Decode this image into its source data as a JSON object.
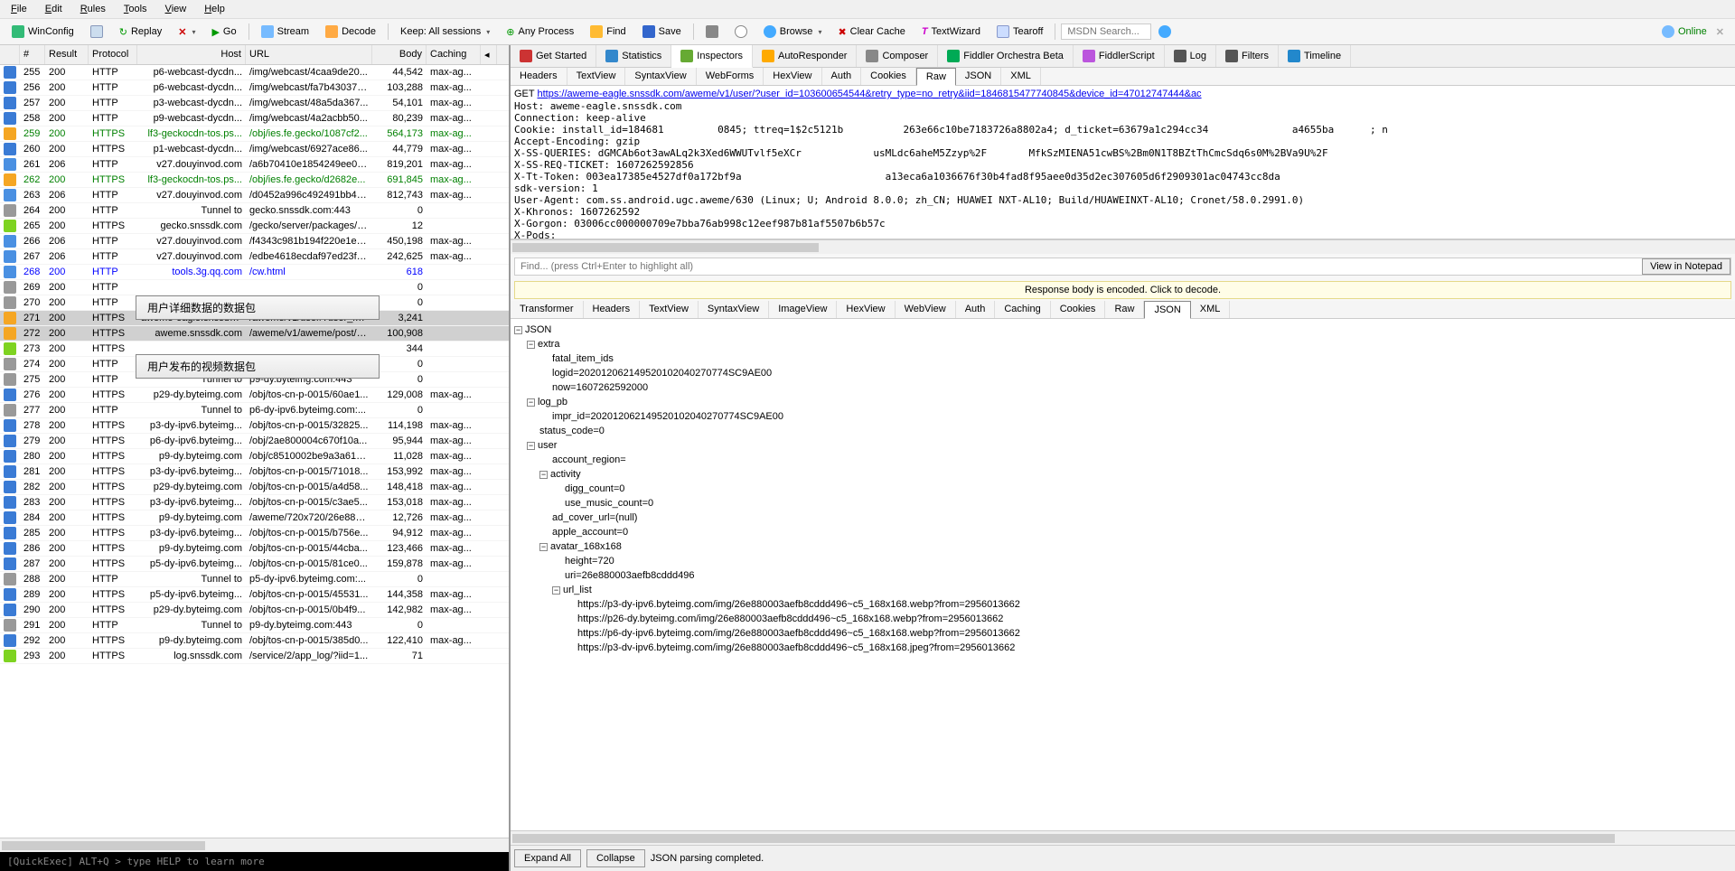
{
  "menu": [
    "File",
    "Edit",
    "Rules",
    "Tools",
    "View",
    "Help"
  ],
  "toolbar": {
    "winconfig": "WinConfig",
    "replay": "Replay",
    "go": "Go",
    "stream": "Stream",
    "decode": "Decode",
    "keep": "Keep: All sessions",
    "any_process": "Any Process",
    "find": "Find",
    "save": "Save",
    "browse": "Browse",
    "clear_cache": "Clear Cache",
    "textwizard": "TextWizard",
    "tearoff": "Tearoff",
    "search_placeholder": "MSDN Search...",
    "online": "Online"
  },
  "session_cols": {
    "id": "#",
    "result": "Result",
    "protocol": "Protocol",
    "host": "Host",
    "url": "URL",
    "body": "Body",
    "caching": "Caching"
  },
  "sessions": [
    {
      "id": "255",
      "result": "200",
      "proto": "HTTP",
      "host": "p6-webcast-dycdn...",
      "url": "/img/webcast/4caa9de20...",
      "body": "44,542",
      "cache": "max-ag...",
      "ico": "img"
    },
    {
      "id": "256",
      "result": "200",
      "proto": "HTTP",
      "host": "p6-webcast-dycdn...",
      "url": "/img/webcast/fa7b43037e...",
      "body": "103,288",
      "cache": "max-ag...",
      "ico": "img"
    },
    {
      "id": "257",
      "result": "200",
      "proto": "HTTP",
      "host": "p3-webcast-dycdn...",
      "url": "/img/webcast/48a5da367...",
      "body": "54,101",
      "cache": "max-ag...",
      "ico": "img"
    },
    {
      "id": "258",
      "result": "200",
      "proto": "HTTP",
      "host": "p9-webcast-dycdn...",
      "url": "/img/webcast/4a2acbb50...",
      "body": "80,239",
      "cache": "max-ag...",
      "ico": "img"
    },
    {
      "id": "259",
      "result": "200",
      "proto": "HTTPS",
      "host": "lf3-geckocdn-tos.ps...",
      "url": "/obj/ies.fe.gecko/1087cf2...",
      "body": "564,173",
      "cache": "max-ag...",
      "ico": "js",
      "green": true
    },
    {
      "id": "260",
      "result": "200",
      "proto": "HTTPS",
      "host": "p1-webcast-dycdn...",
      "url": "/img/webcast/6927ace86...",
      "body": "44,779",
      "cache": "max-ag...",
      "ico": "img"
    },
    {
      "id": "261",
      "result": "206",
      "proto": "HTTP",
      "host": "v27.douyinvod.com",
      "url": "/a6b70410e1854249ee03...",
      "body": "819,201",
      "cache": "max-ag...",
      "ico": "doc"
    },
    {
      "id": "262",
      "result": "200",
      "proto": "HTTPS",
      "host": "lf3-geckocdn-tos.ps...",
      "url": "/obj/ies.fe.gecko/d2682e...",
      "body": "691,845",
      "cache": "max-ag...",
      "ico": "js",
      "green": true
    },
    {
      "id": "263",
      "result": "206",
      "proto": "HTTP",
      "host": "v27.douyinvod.com",
      "url": "/d0452a996c492491bb47...",
      "body": "812,743",
      "cache": "max-ag...",
      "ico": "doc"
    },
    {
      "id": "264",
      "result": "200",
      "proto": "HTTP",
      "host": "Tunnel to",
      "url": "gecko.snssdk.com:443",
      "body": "0",
      "cache": "",
      "ico": "lock"
    },
    {
      "id": "265",
      "result": "200",
      "proto": "HTTPS",
      "host": "gecko.snssdk.com",
      "url": "/gecko/server/packages/s...",
      "body": "12",
      "cache": "",
      "ico": "json"
    },
    {
      "id": "266",
      "result": "206",
      "proto": "HTTP",
      "host": "v27.douyinvod.com",
      "url": "/f4343c981b194f220e1eb...",
      "body": "450,198",
      "cache": "max-ag...",
      "ico": "doc"
    },
    {
      "id": "267",
      "result": "206",
      "proto": "HTTP",
      "host": "v27.douyinvod.com",
      "url": "/edbe4618ecdaf97ed23f9...",
      "body": "242,625",
      "cache": "max-ag...",
      "ico": "doc"
    },
    {
      "id": "268",
      "result": "200",
      "proto": "HTTP",
      "host": "tools.3g.qq.com",
      "url": "/cw.html",
      "body": "618",
      "cache": "",
      "ico": "html",
      "blue": true
    },
    {
      "id": "269",
      "result": "200",
      "proto": "HTTP",
      "host": "",
      "url": "",
      "body": "0",
      "cache": "",
      "ico": "lock"
    },
    {
      "id": "270",
      "result": "200",
      "proto": "HTTP",
      "host": "",
      "url": "",
      "body": "0",
      "cache": "",
      "ico": "lock"
    },
    {
      "id": "271",
      "result": "200",
      "proto": "HTTPS",
      "host": "aweme-eagle.snssdk...",
      "url": "/aweme/v1/user/?user_id...",
      "body": "3,241",
      "cache": "",
      "ico": "js",
      "sel": true
    },
    {
      "id": "272",
      "result": "200",
      "proto": "HTTPS",
      "host": "aweme.snssdk.com",
      "url": "/aweme/v1/aweme/post/?...",
      "body": "100,908",
      "cache": "",
      "ico": "js",
      "sel": true
    },
    {
      "id": "273",
      "result": "200",
      "proto": "HTTPS",
      "host": "",
      "url": "",
      "body": "344",
      "cache": "",
      "ico": "json"
    },
    {
      "id": "274",
      "result": "200",
      "proto": "HTTP",
      "host": "",
      "url": "",
      "body": "0",
      "cache": "",
      "ico": "lock"
    },
    {
      "id": "275",
      "result": "200",
      "proto": "HTTP",
      "host": "Tunnel to",
      "url": "p9-dy.byteimg.com:443",
      "body": "0",
      "cache": "",
      "ico": "lock"
    },
    {
      "id": "276",
      "result": "200",
      "proto": "HTTPS",
      "host": "p29-dy.byteimg.com",
      "url": "/obj/tos-cn-p-0015/60ae1...",
      "body": "129,008",
      "cache": "max-ag...",
      "ico": "img"
    },
    {
      "id": "277",
      "result": "200",
      "proto": "HTTP",
      "host": "Tunnel to",
      "url": "p6-dy-ipv6.byteimg.com:...",
      "body": "0",
      "cache": "",
      "ico": "lock"
    },
    {
      "id": "278",
      "result": "200",
      "proto": "HTTPS",
      "host": "p3-dy-ipv6.byteimg...",
      "url": "/obj/tos-cn-p-0015/32825...",
      "body": "114,198",
      "cache": "max-ag...",
      "ico": "img"
    },
    {
      "id": "279",
      "result": "200",
      "proto": "HTTPS",
      "host": "p6-dy-ipv6.byteimg...",
      "url": "/obj/2ae800004c670f10a...",
      "body": "95,944",
      "cache": "max-ag...",
      "ico": "img"
    },
    {
      "id": "280",
      "result": "200",
      "proto": "HTTPS",
      "host": "p9-dy.byteimg.com",
      "url": "/obj/c8510002be9a3a61a...",
      "body": "11,028",
      "cache": "max-ag...",
      "ico": "img"
    },
    {
      "id": "281",
      "result": "200",
      "proto": "HTTPS",
      "host": "p3-dy-ipv6.byteimg...",
      "url": "/obj/tos-cn-p-0015/71018...",
      "body": "153,992",
      "cache": "max-ag...",
      "ico": "img"
    },
    {
      "id": "282",
      "result": "200",
      "proto": "HTTPS",
      "host": "p29-dy.byteimg.com",
      "url": "/obj/tos-cn-p-0015/a4d58...",
      "body": "148,418",
      "cache": "max-ag...",
      "ico": "img"
    },
    {
      "id": "283",
      "result": "200",
      "proto": "HTTPS",
      "host": "p3-dy-ipv6.byteimg...",
      "url": "/obj/tos-cn-p-0015/c3ae5...",
      "body": "153,018",
      "cache": "max-ag...",
      "ico": "img"
    },
    {
      "id": "284",
      "result": "200",
      "proto": "HTTPS",
      "host": "p9-dy.byteimg.com",
      "url": "/aweme/720x720/26e880...",
      "body": "12,726",
      "cache": "max-ag...",
      "ico": "img"
    },
    {
      "id": "285",
      "result": "200",
      "proto": "HTTPS",
      "host": "p3-dy-ipv6.byteimg...",
      "url": "/obj/tos-cn-p-0015/b756e...",
      "body": "94,912",
      "cache": "max-ag...",
      "ico": "img"
    },
    {
      "id": "286",
      "result": "200",
      "proto": "HTTPS",
      "host": "p9-dy.byteimg.com",
      "url": "/obj/tos-cn-p-0015/44cba...",
      "body": "123,466",
      "cache": "max-ag...",
      "ico": "img"
    },
    {
      "id": "287",
      "result": "200",
      "proto": "HTTPS",
      "host": "p5-dy-ipv6.byteimg...",
      "url": "/obj/tos-cn-p-0015/81ce0...",
      "body": "159,878",
      "cache": "max-ag...",
      "ico": "img"
    },
    {
      "id": "288",
      "result": "200",
      "proto": "HTTP",
      "host": "Tunnel to",
      "url": "p5-dy-ipv6.byteimg.com:...",
      "body": "0",
      "cache": "",
      "ico": "lock"
    },
    {
      "id": "289",
      "result": "200",
      "proto": "HTTPS",
      "host": "p5-dy-ipv6.byteimg...",
      "url": "/obj/tos-cn-p-0015/45531...",
      "body": "144,358",
      "cache": "max-ag...",
      "ico": "img"
    },
    {
      "id": "290",
      "result": "200",
      "proto": "HTTPS",
      "host": "p29-dy.byteimg.com",
      "url": "/obj/tos-cn-p-0015/0b4f9...",
      "body": "142,982",
      "cache": "max-ag...",
      "ico": "img"
    },
    {
      "id": "291",
      "result": "200",
      "proto": "HTTP",
      "host": "Tunnel to",
      "url": "p9-dy.byteimg.com:443",
      "body": "0",
      "cache": "",
      "ico": "lock"
    },
    {
      "id": "292",
      "result": "200",
      "proto": "HTTPS",
      "host": "p9-dy.byteimg.com",
      "url": "/obj/tos-cn-p-0015/385d0...",
      "body": "122,410",
      "cache": "max-ag...",
      "ico": "img"
    },
    {
      "id": "293",
      "result": "200",
      "proto": "HTTPS",
      "host": "log.snssdk.com",
      "url": "/service/2/app_log/?iid=1...",
      "body": "71",
      "cache": "",
      "ico": "json"
    }
  ],
  "annotations": {
    "a1": "用户详细数据的数据包",
    "a2": "用户发布的视频数据包"
  },
  "top_tabs": [
    "Get Started",
    "Statistics",
    "Inspectors",
    "AutoResponder",
    "Composer",
    "Fiddler Orchestra Beta",
    "FiddlerScript",
    "Log",
    "Filters",
    "Timeline"
  ],
  "req_tabs": [
    "Headers",
    "TextView",
    "SyntaxView",
    "WebForms",
    "HexView",
    "Auth",
    "Cookies",
    "Raw",
    "JSON",
    "XML"
  ],
  "resp_tabs": [
    "Transformer",
    "Headers",
    "TextView",
    "SyntaxView",
    "ImageView",
    "HexView",
    "WebView",
    "Auth",
    "Caching",
    "Cookies",
    "Raw",
    "JSON",
    "XML"
  ],
  "req_raw": {
    "method": "GET ",
    "url": "https://aweme-eagle.snssdk.com/aweme/v1/user/?user_id=103600654544&retry_type=no_retry&iid=1846815477740845&device_id=47012747444&ac",
    "lines": [
      "Host: aweme-eagle.snssdk.com",
      "Connection: keep-alive",
      "Cookie: install_id=184681         0845; ttreq=1$2c5121b          263e66c10be7183726a8802a4; d_ticket=63679a1c294cc34              a4655ba      ; n",
      "Accept-Encoding: gzip",
      "X-SS-QUERIES: dGMCAb6ot3awALq2k3Xed6WWUTvlf5eXCr            usMLdc6aheM5Zzyp%2F       MfkSzMIENA51cwBS%2Bm0N1T8BZtThCmcSdq6s0M%2BVa9U%2F",
      "X-SS-REQ-TICKET: 1607262592856",
      "X-Tt-Token: 003ea17385e4527df0a172bf9a                        a13eca6a1036676f30b4fad8f95aee0d35d2ec307605d6f2909301ac04743cc8da",
      "sdk-version: 1",
      "User-Agent: com.ss.android.ugc.aweme/630 (Linux; U; Android 8.0.0; zh_CN; HUAWEI NXT-AL10; Build/HUAWEINXT-AL10; Cronet/58.0.2991.0)",
      "X-Khronos: 1607262592",
      "X-Gorgon: 03006cc000000709e7bba76ab998c12eef987b81af5507b6b57c",
      "X-Pods:"
    ]
  },
  "find_placeholder": "Find... (press Ctrl+Enter to highlight all)",
  "view_notepad": "View in Notepad",
  "decode_msg": "Response body is encoded. Click to decode.",
  "tree": [
    {
      "d": 0,
      "t": "-",
      "l": "JSON"
    },
    {
      "d": 1,
      "t": "-",
      "l": "extra"
    },
    {
      "d": 2,
      "t": "",
      "l": "fatal_item_ids"
    },
    {
      "d": 2,
      "t": "",
      "l": "logid=202012062149520102040270774SC9AE00"
    },
    {
      "d": 2,
      "t": "",
      "l": "now=1607262592000"
    },
    {
      "d": 1,
      "t": "-",
      "l": "log_pb"
    },
    {
      "d": 2,
      "t": "",
      "l": "impr_id=202012062149520102040270774SC9AE00"
    },
    {
      "d": 1,
      "t": "",
      "l": "status_code=0"
    },
    {
      "d": 1,
      "t": "-",
      "l": "user"
    },
    {
      "d": 2,
      "t": "",
      "l": "account_region="
    },
    {
      "d": 2,
      "t": "-",
      "l": "activity"
    },
    {
      "d": 3,
      "t": "",
      "l": "digg_count=0"
    },
    {
      "d": 3,
      "t": "",
      "l": "use_music_count=0"
    },
    {
      "d": 2,
      "t": "",
      "l": "ad_cover_url=(null)"
    },
    {
      "d": 2,
      "t": "",
      "l": "apple_account=0"
    },
    {
      "d": 2,
      "t": "-",
      "l": "avatar_168x168"
    },
    {
      "d": 3,
      "t": "",
      "l": "height=720"
    },
    {
      "d": 3,
      "t": "",
      "l": "uri=26e880003aefb8cddd496"
    },
    {
      "d": 3,
      "t": "-",
      "l": "url_list"
    },
    {
      "d": 4,
      "t": "",
      "l": "https://p3-dy-ipv6.byteimg.com/img/26e880003aefb8cddd496~c5_168x168.webp?from=2956013662"
    },
    {
      "d": 4,
      "t": "",
      "l": "https://p26-dy.byteimg.com/img/26e880003aefb8cddd496~c5_168x168.webp?from=2956013662"
    },
    {
      "d": 4,
      "t": "",
      "l": "https://p6-dy-ipv6.byteimg.com/img/26e880003aefb8cddd496~c5_168x168.webp?from=2956013662"
    },
    {
      "d": 4,
      "t": "",
      "l": "https://p3-dv-ipv6.byteimg.com/img/26e880003aefb8cddd496~c5_168x168.jpeg?from=2956013662"
    }
  ],
  "footer": {
    "expand": "Expand All",
    "collapse": "Collapse",
    "status": "JSON parsing completed."
  },
  "quickexec": "[QuickExec] ALT+Q > type HELP to learn more"
}
